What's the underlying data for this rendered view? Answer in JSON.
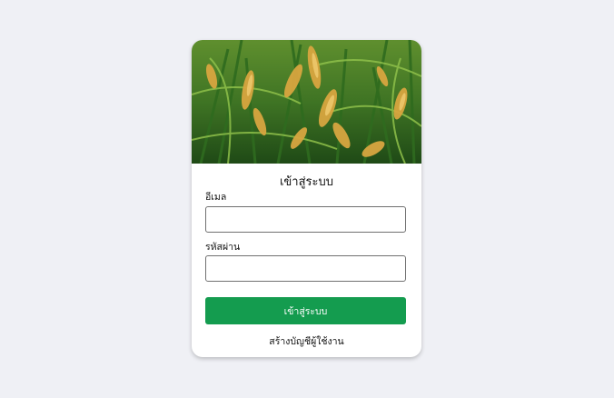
{
  "login": {
    "image_alt": "rice field",
    "title": "เข้าสู่ระบบ",
    "email_label": "อีเมล",
    "email_value": "",
    "password_label": "รหัสผ่าน",
    "password_value": "",
    "submit_label": "เข้าสู่ระบบ",
    "register_link": "สร้างบัญชีผู้ใช้งาน"
  },
  "colors": {
    "background": "#eff0f5",
    "card": "#ffffff",
    "button": "#149c4f",
    "button_text": "#ffffff"
  }
}
